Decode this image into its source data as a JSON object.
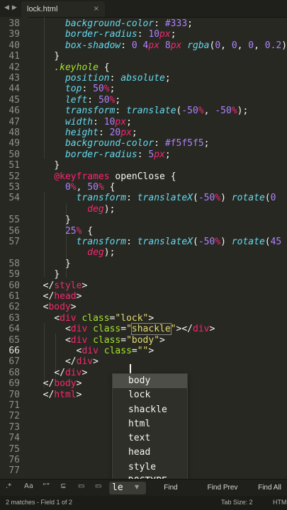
{
  "tab": {
    "title": "lock.html",
    "close": "×"
  },
  "nav": {
    "back": "◀",
    "forward": "▶"
  },
  "gutter": {
    "lines": [
      "38",
      "39",
      "40",
      "41",
      "42",
      "43",
      "44",
      "45",
      "46",
      "47",
      "48",
      "49",
      "50",
      "51",
      "52",
      "53",
      "54",
      "",
      "55",
      "56",
      "57",
      "",
      "58",
      "59",
      "60",
      "61",
      "62",
      "63",
      "64",
      "65",
      "66",
      "67",
      "68",
      "69",
      "70",
      "71",
      "72",
      "73",
      "74",
      "75",
      "76",
      "77"
    ]
  },
  "autocomplete": {
    "items": [
      "body",
      "lock",
      "shackle",
      "html",
      "text",
      "head",
      "style",
      "DOCTYPE"
    ],
    "selected": 0
  },
  "findbar": {
    "icons": {
      "regex": ".*",
      "case": "Aa",
      "word": "“”",
      "wrap": "⊆",
      "selection": "▭",
      "highlight": "▭"
    },
    "input_value": "le",
    "input_dropdown": "▼",
    "find_label": "Find",
    "find_prev_label": "Find Prev",
    "find_all_label": "Find All"
  },
  "status": {
    "left": "2 matches - Field 1 of 2",
    "tab_size": "Tab Size: 2",
    "syntax": "HTM"
  },
  "colors": {
    "background": "#272822",
    "tag": "#f92672",
    "attribute": "#a6e22e",
    "string": "#e6db74",
    "property": "#66d9ef",
    "number": "#ae81ff"
  }
}
